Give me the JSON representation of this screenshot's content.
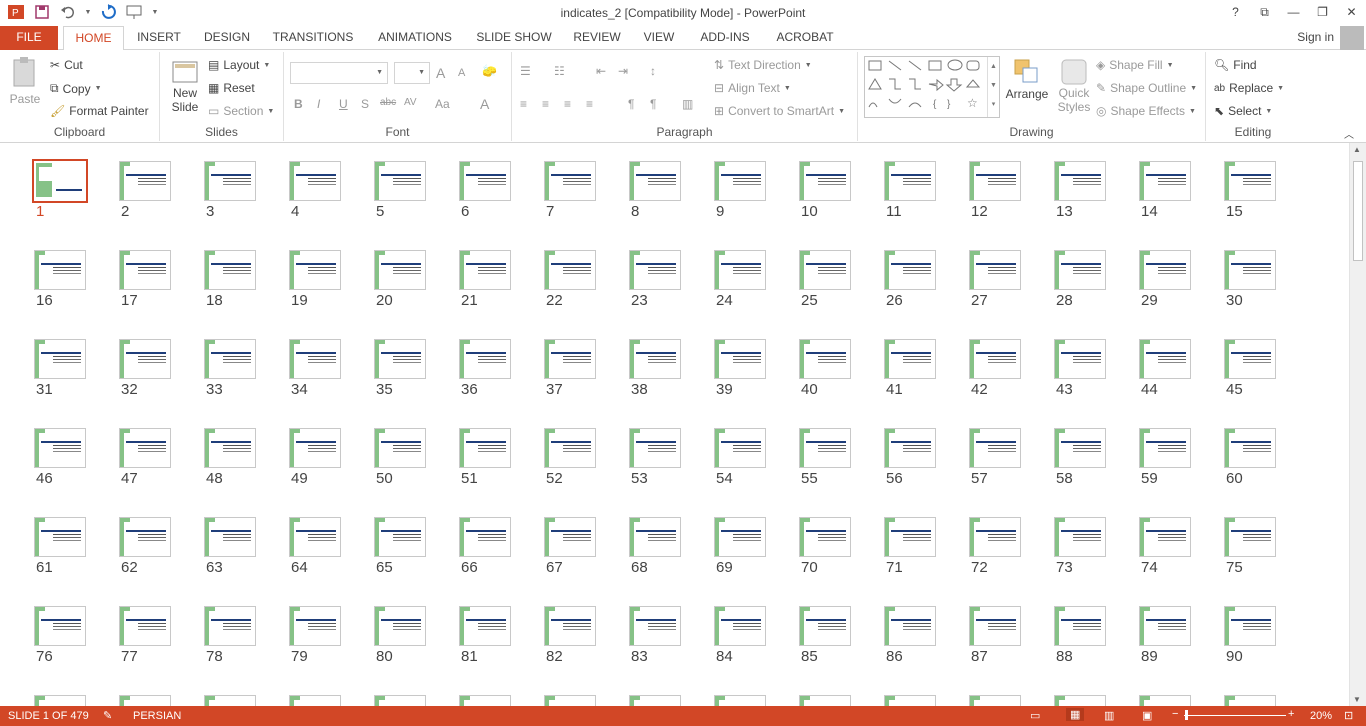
{
  "window": {
    "title": "indicates_2 [Compatibility Mode] - PowerPoint",
    "help": "?",
    "ribbon_display": "ribbon-display-icon",
    "minimize": "minimize-icon",
    "restore": "restore-icon",
    "close": "close-icon"
  },
  "qat": {
    "app": "powerpoint-icon",
    "save": "save-icon",
    "undo": "undo-icon",
    "redo": "redo-icon",
    "present": "present-from-start-icon",
    "customize": "customize-qat-icon"
  },
  "tabs": [
    "FILE",
    "HOME",
    "INSERT",
    "DESIGN",
    "TRANSITIONS",
    "ANIMATIONS",
    "SLIDE SHOW",
    "REVIEW",
    "VIEW",
    "ADD-INS",
    "ACROBAT"
  ],
  "active_tab": "HOME",
  "sign_in": "Sign in",
  "clipboard": {
    "paste": "Paste",
    "cut": "Cut",
    "copy": "Copy",
    "format_painter": "Format Painter",
    "label": "Clipboard"
  },
  "slides_grp": {
    "new_slide_1": "New",
    "new_slide_2": "Slide",
    "layout": "Layout",
    "reset": "Reset",
    "section": "Section",
    "label": "Slides"
  },
  "font": {
    "label": "Font",
    "bold": "B",
    "italic": "I",
    "underline": "U",
    "shadow": "S",
    "strike": "abc",
    "spacing": "AV",
    "case": "Aa",
    "color": "A",
    "grow": "A",
    "shrink": "A"
  },
  "paragraph": {
    "label": "Paragraph",
    "text_direction": "Text Direction",
    "align_text": "Align Text",
    "smartart": "Convert to SmartArt"
  },
  "drawing": {
    "label": "Drawing",
    "arrange": "Arrange",
    "quick_1": "Quick",
    "quick_2": "Styles",
    "shape_fill": "Shape Fill",
    "shape_outline": "Shape Outline",
    "shape_effects": "Shape Effects"
  },
  "editing": {
    "label": "Editing",
    "find": "Find",
    "replace": "Replace",
    "select": "Select"
  },
  "slides": {
    "numbers": [
      1,
      2,
      3,
      4,
      5,
      6,
      7,
      8,
      9,
      10,
      11,
      12,
      13,
      14,
      15,
      16,
      17,
      18,
      19,
      20,
      21,
      22,
      23,
      24,
      25,
      26,
      27,
      28,
      29,
      30,
      31,
      32,
      33,
      34,
      35,
      36,
      37,
      38,
      39,
      40,
      41,
      42,
      43,
      44,
      45,
      46,
      47,
      48,
      49,
      50,
      51,
      52,
      53,
      54,
      55,
      56,
      57,
      58,
      59,
      60,
      61,
      62,
      63,
      64,
      65,
      66,
      67,
      68,
      69,
      70,
      71,
      72,
      73,
      74,
      75,
      76,
      77,
      78,
      79,
      80,
      81,
      82,
      83,
      84,
      85,
      86,
      87,
      88,
      89,
      90
    ],
    "selected": 1
  },
  "status": {
    "slide": "SLIDE 1 OF 479",
    "language": "PERSIAN",
    "zoom": "20%",
    "zoom_minus": "−",
    "zoom_plus": "+"
  }
}
